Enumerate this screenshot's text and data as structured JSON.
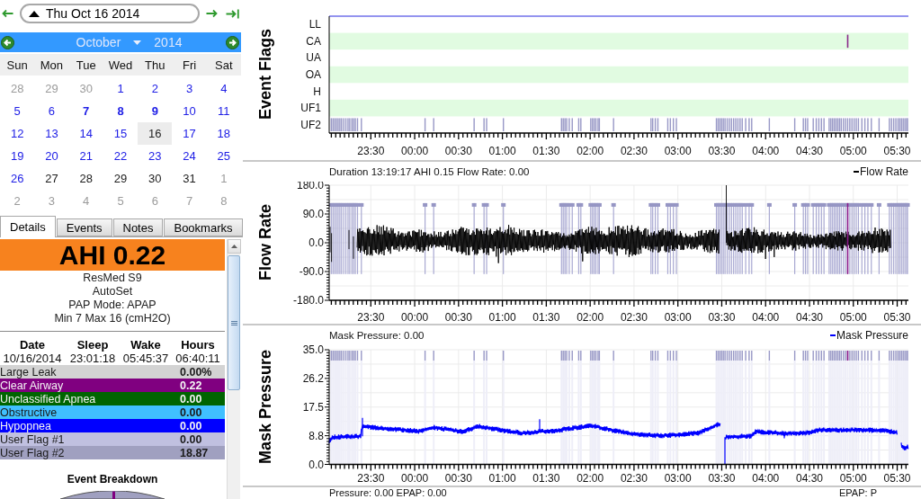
{
  "date_bar": {
    "date": "Thu Oct 16 2014"
  },
  "calendar": {
    "month": "October",
    "year": "2014",
    "weekdays": [
      "Sun",
      "Mon",
      "Tue",
      "Wed",
      "Thu",
      "Fri",
      "Sat"
    ],
    "weeks": [
      [
        {
          "day": "28",
          "kind": "other",
          "bold": false,
          "selected": false
        },
        {
          "day": "29",
          "kind": "other",
          "bold": false,
          "selected": false
        },
        {
          "day": "30",
          "kind": "other",
          "bold": false,
          "selected": false
        },
        {
          "day": "1",
          "kind": "data",
          "bold": false,
          "selected": false
        },
        {
          "day": "2",
          "kind": "data",
          "bold": false,
          "selected": false
        },
        {
          "day": "3",
          "kind": "data",
          "bold": false,
          "selected": false
        },
        {
          "day": "4",
          "kind": "data",
          "bold": false,
          "selected": false
        }
      ],
      [
        {
          "day": "5",
          "kind": "data",
          "bold": false,
          "selected": false
        },
        {
          "day": "6",
          "kind": "data",
          "bold": false,
          "selected": false
        },
        {
          "day": "7",
          "kind": "data",
          "bold": true,
          "selected": false
        },
        {
          "day": "8",
          "kind": "data",
          "bold": true,
          "selected": false
        },
        {
          "day": "9",
          "kind": "data",
          "bold": true,
          "selected": false
        },
        {
          "day": "10",
          "kind": "data",
          "bold": false,
          "selected": false
        },
        {
          "day": "11",
          "kind": "data",
          "bold": false,
          "selected": false
        }
      ],
      [
        {
          "day": "12",
          "kind": "data",
          "bold": false,
          "selected": false
        },
        {
          "day": "13",
          "kind": "data",
          "bold": false,
          "selected": false
        },
        {
          "day": "14",
          "kind": "data",
          "bold": false,
          "selected": false
        },
        {
          "day": "15",
          "kind": "data",
          "bold": false,
          "selected": false
        },
        {
          "day": "16",
          "kind": "data",
          "bold": false,
          "selected": true
        },
        {
          "day": "17",
          "kind": "data",
          "bold": false,
          "selected": false
        },
        {
          "day": "18",
          "kind": "data",
          "bold": false,
          "selected": false
        }
      ],
      [
        {
          "day": "19",
          "kind": "data",
          "bold": false,
          "selected": false
        },
        {
          "day": "20",
          "kind": "data",
          "bold": false,
          "selected": false
        },
        {
          "day": "21",
          "kind": "data",
          "bold": false,
          "selected": false
        },
        {
          "day": "22",
          "kind": "data",
          "bold": false,
          "selected": false
        },
        {
          "day": "23",
          "kind": "data",
          "bold": false,
          "selected": false
        },
        {
          "day": "24",
          "kind": "data",
          "bold": false,
          "selected": false
        },
        {
          "day": "25",
          "kind": "data",
          "bold": false,
          "selected": false
        }
      ],
      [
        {
          "day": "26",
          "kind": "data",
          "bold": false,
          "selected": false
        },
        {
          "day": "27",
          "kind": "plain",
          "bold": false,
          "selected": false
        },
        {
          "day": "28",
          "kind": "plain",
          "bold": false,
          "selected": false
        },
        {
          "day": "29",
          "kind": "plain",
          "bold": false,
          "selected": false
        },
        {
          "day": "30",
          "kind": "plain",
          "bold": false,
          "selected": false
        },
        {
          "day": "31",
          "kind": "plain",
          "bold": false,
          "selected": false
        },
        {
          "day": "1",
          "kind": "other",
          "bold": false,
          "selected": false
        }
      ],
      [
        {
          "day": "2",
          "kind": "other",
          "bold": false,
          "selected": false
        },
        {
          "day": "3",
          "kind": "other",
          "bold": false,
          "selected": false
        },
        {
          "day": "4",
          "kind": "other",
          "bold": false,
          "selected": false
        },
        {
          "day": "5",
          "kind": "other",
          "bold": false,
          "selected": false
        },
        {
          "day": "6",
          "kind": "other",
          "bold": false,
          "selected": false
        },
        {
          "day": "7",
          "kind": "other",
          "bold": false,
          "selected": false
        },
        {
          "day": "8",
          "kind": "other",
          "bold": false,
          "selected": false
        }
      ]
    ]
  },
  "tabs": [
    {
      "label": "Details",
      "selected": true
    },
    {
      "label": "Events",
      "selected": false
    },
    {
      "label": "Notes",
      "selected": false
    },
    {
      "label": "Bookmarks",
      "selected": false
    }
  ],
  "details": {
    "ahi": "AHI 0.22",
    "device": [
      "ResMed S9",
      "AutoSet",
      "PAP Mode: APAP",
      "Min 7 Max 16 (cmH2O)"
    ],
    "session": {
      "columns": [
        "Date",
        "Sleep",
        "Wake",
        "Hours"
      ],
      "values": [
        "10/16/2014",
        "23:01:18",
        "05:45:37",
        "06:40:11"
      ]
    },
    "events": [
      {
        "name": "Large Leak",
        "value": "0.00%",
        "color": "#d3d3d3"
      },
      {
        "name": "Clear Airway",
        "value": "0.22",
        "color": "#800080"
      },
      {
        "name": "Unclassified Apnea",
        "value": "0.00",
        "color": "#006400"
      },
      {
        "name": "Obstructive",
        "value": "0.00",
        "color": "#40c0ff"
      },
      {
        "name": "Hypopnea",
        "value": "0.00",
        "color": "#0000ff"
      },
      {
        "name": "User Flag #1",
        "value": "0.00",
        "color": "#c0c0e0"
      },
      {
        "name": "User Flag #2",
        "value": "18.87",
        "color": "#a0a0c0"
      }
    ],
    "breakdown_title": "Event Breakdown"
  },
  "charts": [
    {
      "kind": "flags",
      "title": "Event Flags",
      "rows": [
        "LL",
        "CA",
        "UA",
        "OA",
        "H",
        "UF1",
        "UF2"
      ],
      "x_labels": [
        "23:30",
        "00:00",
        "00:30",
        "01:00",
        "01:30",
        "02:00",
        "02:30",
        "03:00",
        "03:30",
        "04:00",
        "04:30",
        "05:00",
        "05:30"
      ]
    },
    {
      "kind": "flow",
      "title": "Flow Rate",
      "header": "Duration 13:19:17 AHI 0.15 Flow Rate: 0.00",
      "legend": "Flow Rate",
      "color": "#000000",
      "y_labels": [
        "180.0",
        "90.0",
        "0.0",
        "-90.0",
        "-180.0"
      ],
      "x_labels": [
        "23:30",
        "00:00",
        "00:30",
        "01:00",
        "01:30",
        "02:00",
        "02:30",
        "03:00",
        "03:30",
        "04:00",
        "04:30",
        "05:00",
        "05:30"
      ]
    },
    {
      "kind": "pressure",
      "title": "Mask Pressure",
      "header": "Mask Pressure: 0.00",
      "legend": "Mask Pressure",
      "color": "#0000ff",
      "y_labels": [
        "35.0",
        "26.2",
        "17.5",
        "8.8",
        "0.0"
      ],
      "x_labels": [
        "23:30",
        "00:00",
        "00:30",
        "01:00",
        "01:30",
        "02:00",
        "02:30",
        "03:00",
        "03:30",
        "04:00",
        "04:30",
        "05:00",
        "05:30"
      ]
    }
  ],
  "footer": {
    "left": "Pressure: 0.00 EPAP: 0.00",
    "right": "EPAP: P"
  }
}
